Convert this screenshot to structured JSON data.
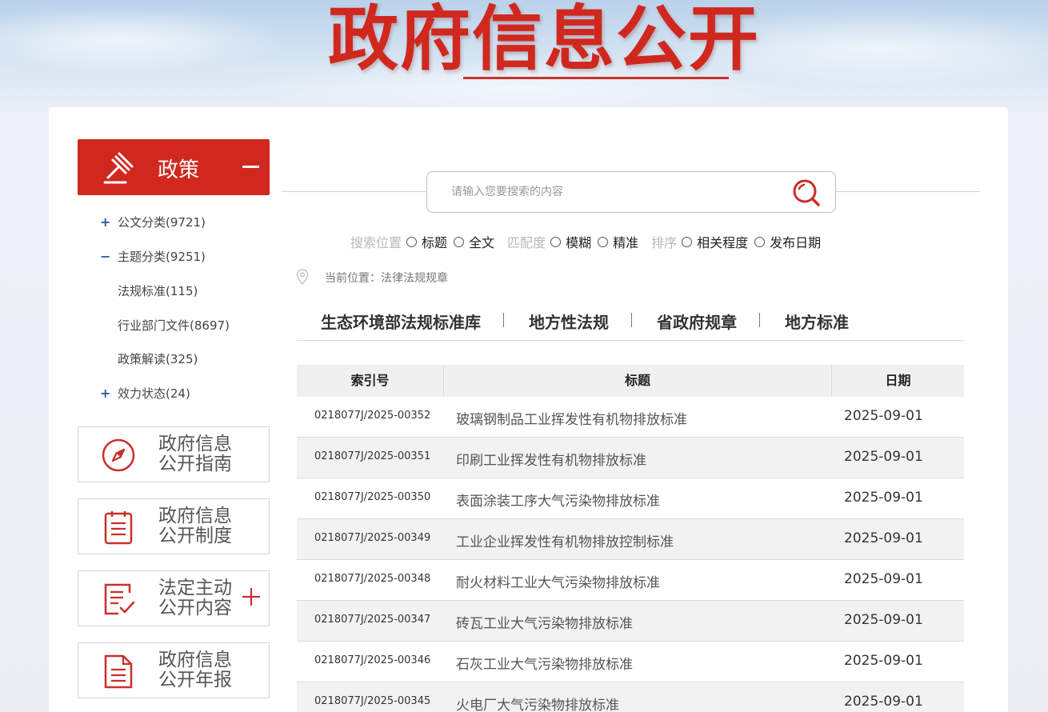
{
  "banner": {
    "title": "政府信息公开"
  },
  "sidebar": {
    "policy": {
      "label": "政策",
      "icon": "gavel-icon"
    },
    "tree": [
      {
        "sign": "+",
        "label": "公文分类(9721)"
      },
      {
        "sign": "−",
        "label": "主题分类(9251)"
      },
      {
        "sign": "",
        "label": "法规标准(115)"
      },
      {
        "sign": "",
        "label": "行业部门文件(8697)"
      },
      {
        "sign": "",
        "label": "政策解读(325)"
      },
      {
        "sign": "+",
        "label": "效力状态(24)"
      }
    ],
    "boxes": [
      {
        "line1": "政府信息",
        "line2": "公开指南",
        "icon": "compass-icon"
      },
      {
        "line1": "政府信息",
        "line2": "公开制度",
        "icon": "clipboard-icon"
      },
      {
        "line1": "法定主动",
        "line2": "公开内容",
        "icon": "edit-document-icon",
        "expandable": true
      },
      {
        "line1": "政府信息",
        "line2": "公开年报",
        "icon": "document-icon"
      }
    ]
  },
  "search": {
    "placeholder": "请输入您要搜索的内容",
    "groups": [
      {
        "label": "搜索位置",
        "options": [
          "标题",
          "全文"
        ]
      },
      {
        "label": "匹配度",
        "options": [
          "模糊",
          "精准"
        ]
      },
      {
        "label": "排序",
        "options": [
          "相关程度",
          "发布日期"
        ]
      }
    ]
  },
  "location": {
    "text": "当前位置：法律法规规章"
  },
  "tabs": [
    "生态环境部法规标准库",
    "地方性法规",
    "省政府规章",
    "地方标准"
  ],
  "table": {
    "headers": [
      "索引号",
      "标题",
      "日期"
    ],
    "rows": [
      {
        "index": "0218077J/2025-00352",
        "title": "玻璃钢制品工业挥发性有机物排放标准",
        "date": "2025-09-01"
      },
      {
        "index": "0218077J/2025-00351",
        "title": "印刷工业挥发性有机物排放标准",
        "date": "2025-09-01"
      },
      {
        "index": "0218077J/2025-00350",
        "title": "表面涂装工序大气污染物排放标准",
        "date": "2025-09-01"
      },
      {
        "index": "0218077J/2025-00349",
        "title": "工业企业挥发性有机物排放控制标准",
        "date": "2025-09-01"
      },
      {
        "index": "0218077J/2025-00348",
        "title": "耐火材料工业大气污染物排放标准",
        "date": "2025-09-01"
      },
      {
        "index": "0218077J/2025-00347",
        "title": "砖瓦工业大气污染物排放标准",
        "date": "2025-09-01"
      },
      {
        "index": "0218077J/2025-00346",
        "title": "石灰工业大气污染物排放标准",
        "date": "2025-09-01"
      },
      {
        "index": "0218077J/2025-00345",
        "title": "火电厂大气污染物排放标准",
        "date": "2025-09-01"
      }
    ]
  },
  "colors": {
    "accent": "#d0281f",
    "tree_sign": "#2a5fa8"
  }
}
